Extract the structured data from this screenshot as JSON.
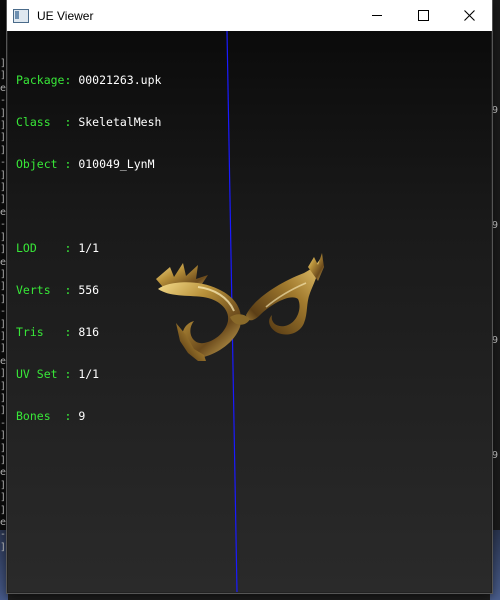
{
  "window": {
    "title": "UE Viewer",
    "icon": "app-window-icon",
    "controls": {
      "minimize": "minimize-icon",
      "maximize": "maximize-icon",
      "close": "close-icon"
    }
  },
  "info": {
    "package": {
      "key": "Package",
      "value": "00021263.upk"
    },
    "class": {
      "key": "Class  ",
      "value": "SkeletalMesh"
    },
    "object": {
      "key": "Object ",
      "value": "010049_LynM"
    },
    "lod": {
      "key": "LOD    ",
      "value": "1/1"
    },
    "verts": {
      "key": "Verts  ",
      "value": "556"
    },
    "tris": {
      "key": "Tris   ",
      "value": "816"
    },
    "uvset": {
      "key": "UV Set ",
      "value": "1/1"
    },
    "bones": {
      "key": "Bones  ",
      "value": "9"
    }
  },
  "colors": {
    "label": "#38e838",
    "value": "#ffffff",
    "axis": "#1a1aff",
    "mask_gold": "#b8913a"
  },
  "background_console": {
    "left_glyphs": [
      "]",
      "]",
      "e",
      "-",
      "]",
      "]",
      "]",
      "]",
      "-",
      "]",
      "]",
      "]",
      "e",
      "-",
      "]",
      "]",
      "e",
      "]",
      "]",
      "]",
      "-",
      "]",
      "]",
      "]",
      "e",
      "]",
      "]",
      "]",
      "]",
      "-",
      "]",
      "]",
      "]",
      "e",
      "]",
      "]",
      "]",
      "e",
      "-",
      "]"
    ],
    "right_glyphs": [
      "9",
      "9",
      "9",
      "9"
    ]
  }
}
